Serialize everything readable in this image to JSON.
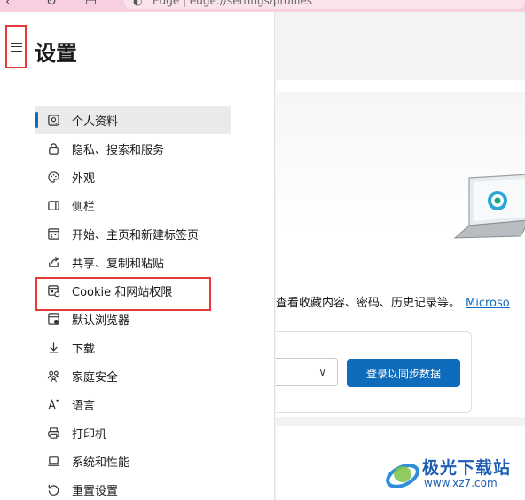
{
  "browser": {
    "address_text": "Edge  |  edge://settings/profiles",
    "icons": [
      "back-icon",
      "refresh-icon",
      "tabs-icon",
      "edge-logo-icon"
    ]
  },
  "sidebar": {
    "title": "设置",
    "items": [
      {
        "label": "个人资料",
        "icon": "profile-icon",
        "active": true
      },
      {
        "label": "隐私、搜索和服务",
        "icon": "lock-icon"
      },
      {
        "label": "外观",
        "icon": "palette-icon"
      },
      {
        "label": "侧栏",
        "icon": "sidebar-icon"
      },
      {
        "label": "开始、主页和新建标签页",
        "icon": "home-grid-icon"
      },
      {
        "label": "共享、复制和粘贴",
        "icon": "share-icon"
      },
      {
        "label": "Cookie 和网站权限",
        "icon": "cookie-permissions-icon",
        "highlighted": true
      },
      {
        "label": "默认浏览器",
        "icon": "browser-icon"
      },
      {
        "label": "下载",
        "icon": "download-icon"
      },
      {
        "label": "家庭安全",
        "icon": "family-icon"
      },
      {
        "label": "语言",
        "icon": "language-icon"
      },
      {
        "label": "打印机",
        "icon": "printer-icon"
      },
      {
        "label": "系统和性能",
        "icon": "laptop-icon"
      },
      {
        "label": "重置设置",
        "icon": "reset-icon"
      }
    ]
  },
  "main": {
    "description": "查看收藏内容、密码、历史记录等。",
    "link_text": "Microso",
    "sync_button": "登录以同步数据"
  },
  "watermark": {
    "title": "极光下载站",
    "url": "www.xz7.com"
  },
  "colors": {
    "accent": "#0f6cbd",
    "highlight": "#e53935",
    "topbar": "#f7cfe0"
  }
}
